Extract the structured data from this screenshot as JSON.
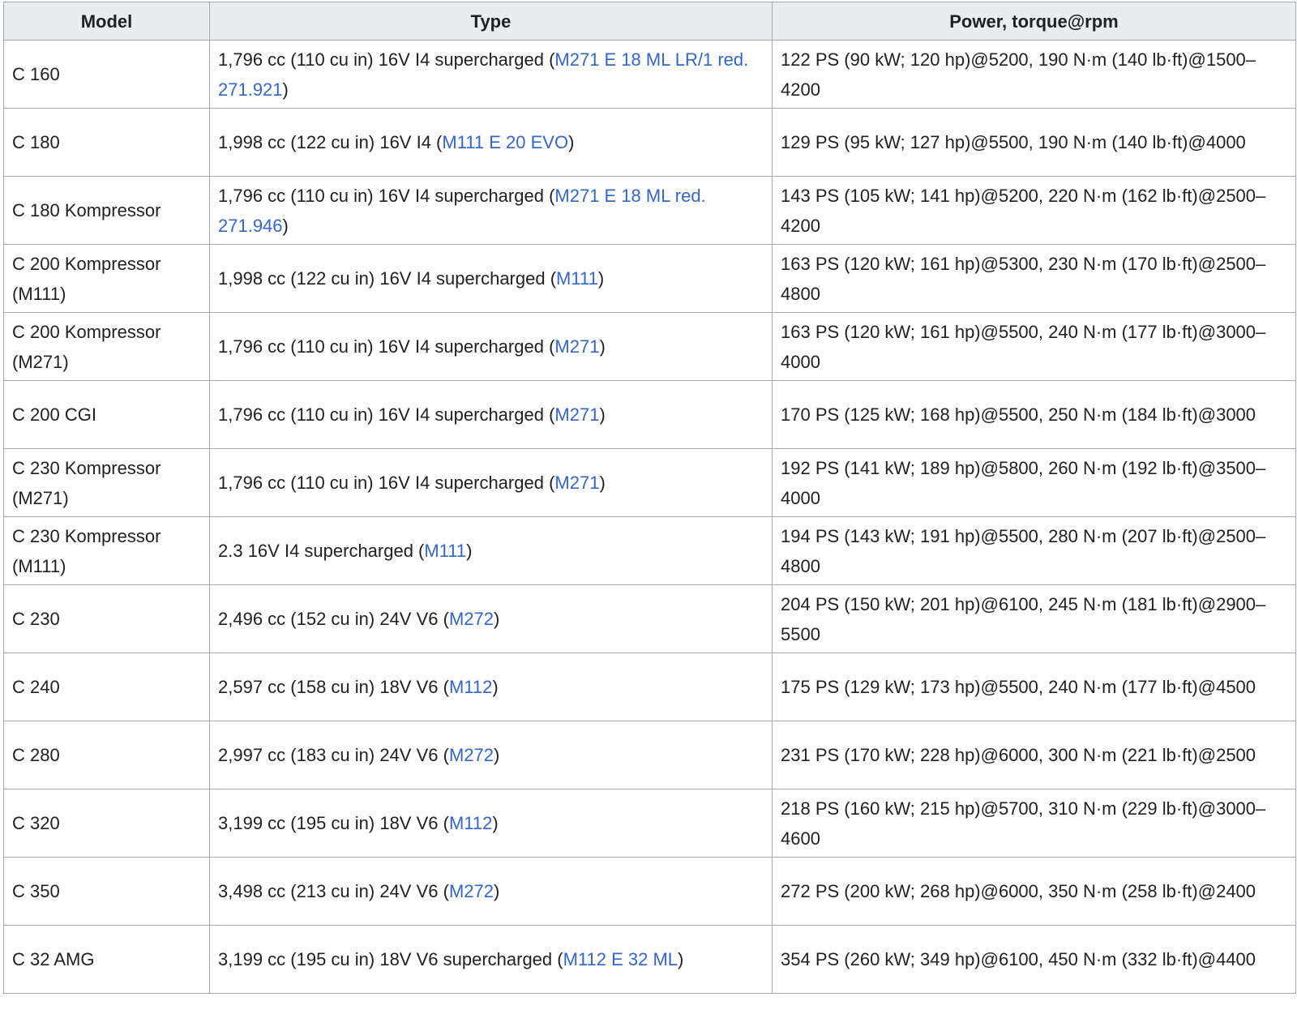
{
  "table": {
    "headers": [
      "Model",
      "Type",
      "Power, torque@rpm"
    ],
    "rows": [
      {
        "model": "C 160",
        "type_pre": "1,796 cc (110 cu in) 16V I4 supercharged (",
        "type_link": "M271 E 18 ML LR/1 red. 271.921",
        "type_post": ")",
        "power": "122 PS (90 kW; 120 hp)@5200, 190 N·m (140 lb·ft)@1500–4200"
      },
      {
        "model": "C 180",
        "type_pre": "1,998 cc (122 cu in) 16V I4 (",
        "type_link": "M111 E 20 EVO",
        "type_post": ")",
        "power": "129 PS (95 kW; 127 hp)@5500, 190 N·m (140 lb·ft)@4000"
      },
      {
        "model": "C 180 Kompressor",
        "type_pre": "1,796 cc (110 cu in) 16V I4 supercharged (",
        "type_link": "M271 E 18 ML red. 271.946",
        "type_post": ")",
        "power": "143 PS (105 kW; 141 hp)@5200, 220 N·m (162 lb·ft)@2500–4200"
      },
      {
        "model": "C 200 Kompressor (M111)",
        "type_pre": "1,998 cc (122 cu in) 16V I4 supercharged (",
        "type_link": "M111",
        "type_post": ")",
        "power": "163 PS (120 kW; 161 hp)@5300, 230 N·m (170 lb·ft)@2500–4800"
      },
      {
        "model": "C 200 Kompressor (M271)",
        "type_pre": "1,796 cc (110 cu in) 16V I4 supercharged (",
        "type_link": "M271",
        "type_post": ")",
        "power": "163 PS (120 kW; 161 hp)@5500, 240 N·m (177 lb·ft)@3000–4000"
      },
      {
        "model": "C 200 CGI",
        "type_pre": "1,796 cc (110 cu in) 16V I4 supercharged (",
        "type_link": "M271",
        "type_post": ")",
        "power": "170 PS (125 kW; 168 hp)@5500, 250 N·m (184 lb·ft)@3000"
      },
      {
        "model": "C 230 Kompressor (M271)",
        "type_pre": "1,796 cc (110 cu in) 16V I4 supercharged (",
        "type_link": "M271",
        "type_post": ")",
        "power": "192 PS (141 kW; 189 hp)@5800, 260 N·m (192 lb·ft)@3500–4000"
      },
      {
        "model": "C 230 Kompressor (M111)",
        "type_pre": "2.3 16V I4 supercharged (",
        "type_link": "M111",
        "type_post": ")",
        "power": "194 PS (143 kW; 191 hp)@5500, 280 N·m (207 lb·ft)@2500–4800"
      },
      {
        "model": "C 230",
        "type_pre": "2,496 cc (152 cu in) 24V V6 (",
        "type_link": "M272",
        "type_post": ")",
        "power": "204 PS (150 kW; 201 hp)@6100, 245 N·m (181 lb·ft)@2900–5500"
      },
      {
        "model": "C 240",
        "type_pre": "2,597 cc (158 cu in) 18V V6 (",
        "type_link": "M112",
        "type_post": ")",
        "power": "175 PS (129 kW; 173 hp)@5500, 240 N·m (177 lb·ft)@4500"
      },
      {
        "model": "C 280",
        "type_pre": "2,997 cc (183 cu in) 24V V6 (",
        "type_link": "M272",
        "type_post": ")",
        "power": "231 PS (170 kW; 228 hp)@6000, 300 N·m (221 lb·ft)@2500"
      },
      {
        "model": "C 320",
        "type_pre": "3,199 cc (195 cu in) 18V V6 (",
        "type_link": "M112",
        "type_post": ")",
        "power": "218 PS (160 kW; 215 hp)@5700, 310 N·m (229 lb·ft)@3000–4600"
      },
      {
        "model": "C 350",
        "type_pre": "3,498 cc (213 cu in) 24V V6 (",
        "type_link": "M272",
        "type_post": ")",
        "power": "272 PS (200 kW; 268 hp)@6000, 350 N·m (258 lb·ft)@2400"
      },
      {
        "model": "C 32 AMG",
        "type_pre": "3,199 cc (195 cu in) 18V V6 supercharged (",
        "type_link": "M112 E 32 ML",
        "type_post": ")",
        "power": "354 PS (260 kW; 349 hp)@6100, 450 N·m (332 lb·ft)@4400"
      }
    ]
  },
  "colors": {
    "link": "#3366cc",
    "header_bg": "#eaecf0",
    "border": "#a2a9b1",
    "text": "#202122"
  }
}
